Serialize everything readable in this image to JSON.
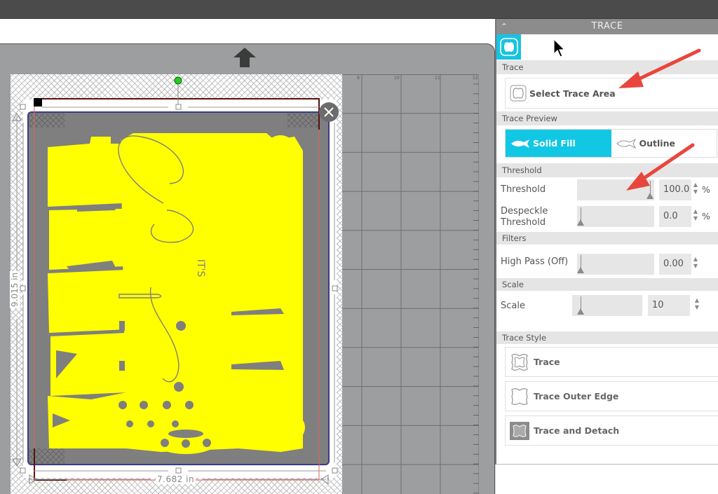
{
  "canvas": {
    "ruler_numbers": [
      "9",
      "10",
      "11",
      "12"
    ],
    "selection": {
      "height_label": "9.015 in",
      "width_label": "7.682 in"
    },
    "design": {
      "text_small": "IT'S",
      "script_word": "Cheer"
    },
    "colors": {
      "trace_fill": "#ffff00",
      "image_bg": "#7f7f7f",
      "mat": "#9d9e9f",
      "selection_border": "#3a3b8a",
      "trace_area_border": "#e06060"
    }
  },
  "panel": {
    "title": "TRACE",
    "collapse_icon": "chevron-up-icon",
    "tab_icon": "trace-tab-icon",
    "sections": {
      "trace": "Trace",
      "trace_preview": "Trace Preview",
      "threshold": "Threshold",
      "filters": "Filters",
      "scale": "Scale",
      "trace_style": "Trace Style"
    },
    "select_trace_area": "Select Trace Area",
    "preview": {
      "solid_fill": "Solid Fill",
      "outline": "Outline",
      "selected": "Solid Fill"
    },
    "params": {
      "threshold": {
        "label": "Threshold",
        "value": "100.0",
        "unit": "%",
        "fraction": 1.0
      },
      "despeckle": {
        "label_line1": "Despeckle",
        "label_line2": "Threshold",
        "value": "0.0",
        "unit": "%",
        "fraction": 0.0
      },
      "high_pass": {
        "label": "High Pass (Off)",
        "value": "0.00",
        "fraction": 0.0
      },
      "scale": {
        "label": "Scale",
        "value": "10",
        "fraction": 0.0
      }
    },
    "styles": {
      "trace": "Trace",
      "trace_outer_edge": "Trace Outer Edge",
      "trace_and_detach": "Trace and Detach"
    },
    "accent_color": "#12c7e4"
  },
  "annotations": {
    "arrow_color": "#e8463c"
  }
}
